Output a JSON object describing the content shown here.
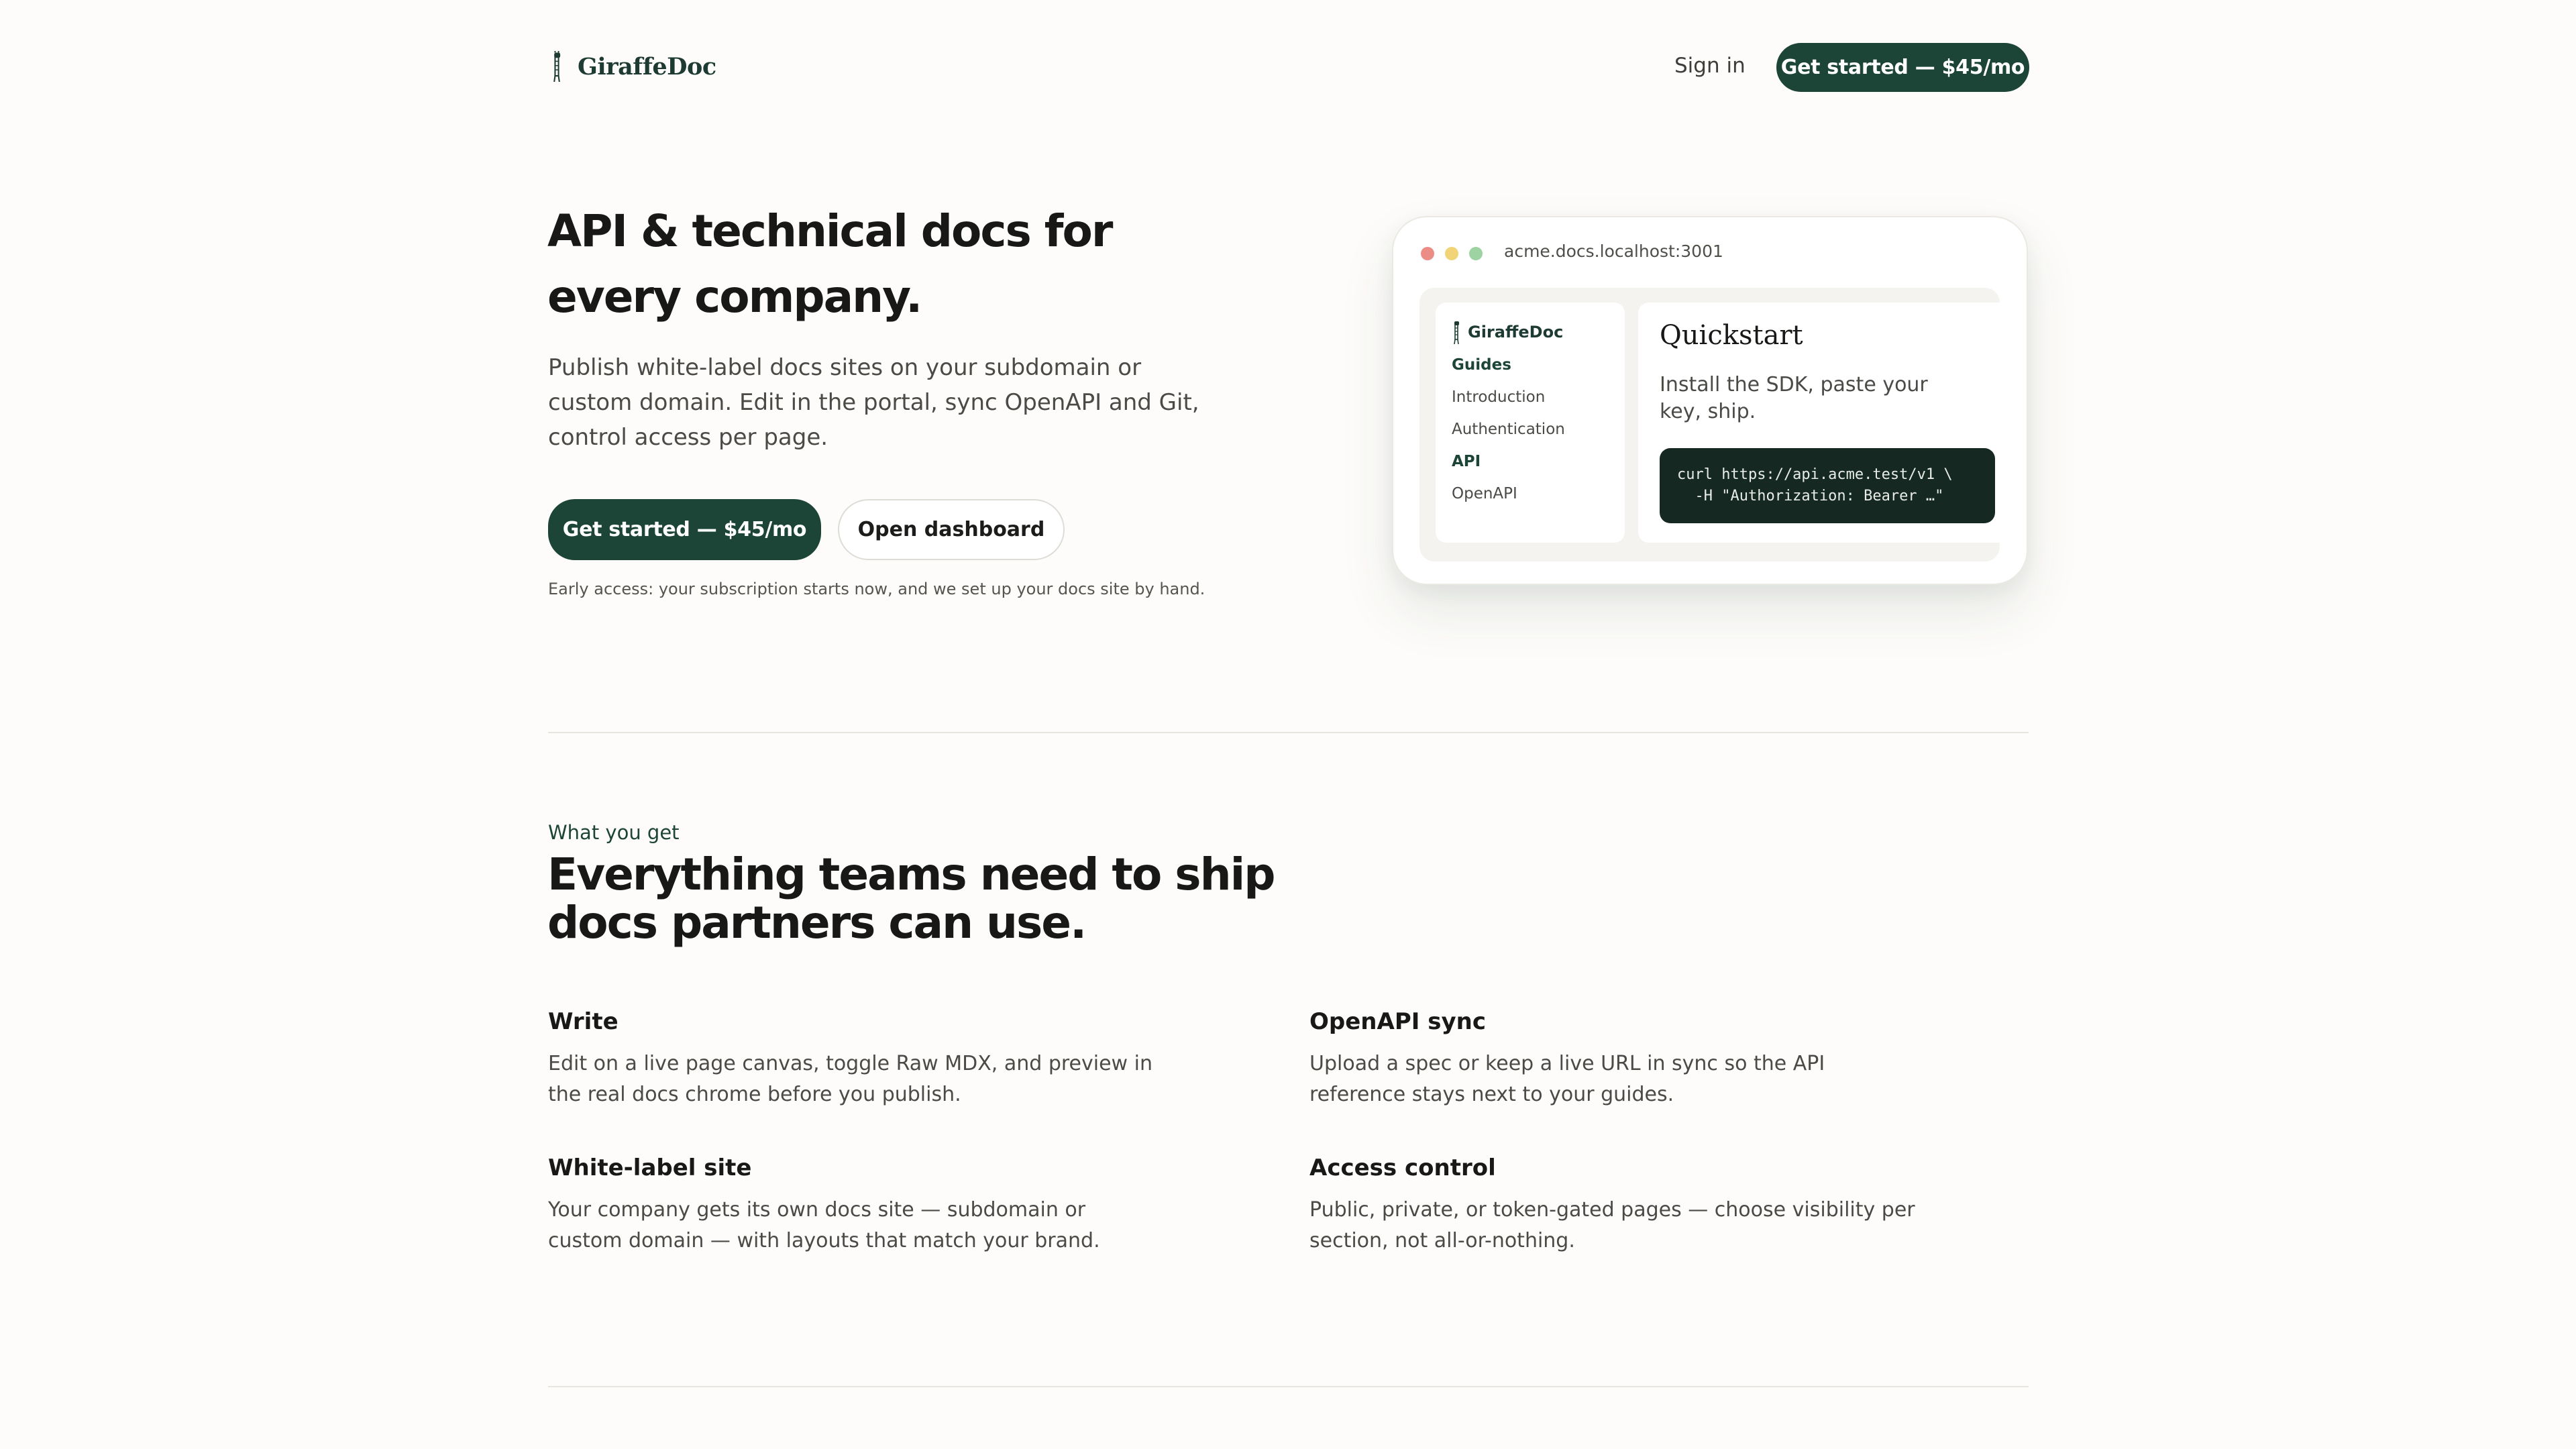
{
  "header": {
    "brand": "GiraffeDoc",
    "logo_icon": "giraffe-icon",
    "sign_in": "Sign in",
    "cta": "Get started — $45/mo"
  },
  "hero": {
    "title": "API & technical docs for every company.",
    "subtitle": "Publish white-label docs sites on your subdomain or custom domain. Edit in the portal, sync OpenAPI and Git, control access per page.",
    "cta_primary": "Get started — $45/mo",
    "cta_secondary": "Open dashboard",
    "note": "Early access: your subscription starts now, and we set up your docs site by hand."
  },
  "preview": {
    "url": "acme.docs.localhost:3001",
    "sidebar": {
      "brand": "GiraffeDoc",
      "items": [
        {
          "label": "Guides",
          "heading": true
        },
        {
          "label": "Introduction",
          "heading": false
        },
        {
          "label": "Authentication",
          "heading": false
        },
        {
          "label": "API",
          "heading": true
        },
        {
          "label": "OpenAPI",
          "heading": false
        }
      ]
    },
    "page": {
      "title": "Quickstart",
      "text": "Install the SDK, paste your key, ship.",
      "code": "curl https://api.acme.test/v1 \\\n  -H \"Authorization: Bearer …\""
    }
  },
  "features": {
    "eyebrow": "What you get",
    "title": "Everything teams need to ship docs partners can use.",
    "items": [
      {
        "title": "Write",
        "text": "Edit on a live page canvas, toggle Raw MDX, and preview in the real docs chrome before you publish."
      },
      {
        "title": "OpenAPI sync",
        "text": "Upload a spec or keep a live URL in sync so the API reference stays next to your guides."
      },
      {
        "title": "White-label site",
        "text": "Your company gets its own docs site — subdomain or custom domain — with layouts that match your brand."
      },
      {
        "title": "Access control",
        "text": "Public, private, or token-gated pages — choose visibility per section, not all-or-nothing."
      }
    ]
  },
  "colors": {
    "brand": "#1c4538",
    "background": "#fdfcfa",
    "code_bg": "#152821"
  }
}
